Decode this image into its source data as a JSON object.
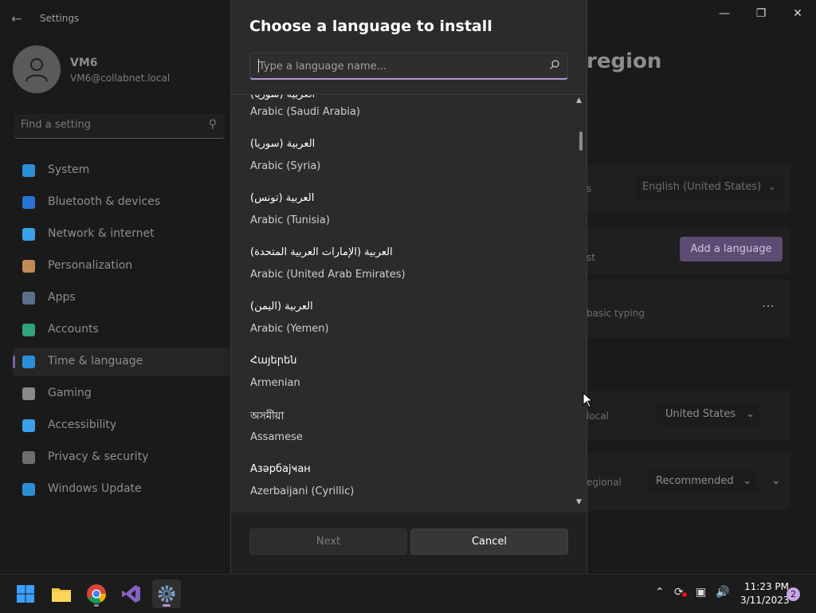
{
  "settings": {
    "title": "Settings",
    "user": {
      "name": "VM6",
      "email": "VM6@collabnet.local"
    },
    "search_placeholder": "Find a setting",
    "nav": [
      {
        "label": "System",
        "icon": "system-icon",
        "color": "#2b8fd6"
      },
      {
        "label": "Bluetooth & devices",
        "icon": "bluetooth-icon",
        "color": "#2b73d6"
      },
      {
        "label": "Network & internet",
        "icon": "wifi-icon",
        "color": "#3aa0e8"
      },
      {
        "label": "Personalization",
        "icon": "brush-icon",
        "color": "#c08a58"
      },
      {
        "label": "Apps",
        "icon": "apps-icon",
        "color": "#5a6f8a"
      },
      {
        "label": "Accounts",
        "icon": "accounts-icon",
        "color": "#2fa37a"
      },
      {
        "label": "Time & language",
        "icon": "globe-icon",
        "color": "#2b8fd6"
      },
      {
        "label": "Gaming",
        "icon": "controller-icon",
        "color": "#8a8a8a"
      },
      {
        "label": "Accessibility",
        "icon": "accessibility-icon",
        "color": "#3aa0e8"
      },
      {
        "label": "Privacy & security",
        "icon": "shield-icon",
        "color": "#6e6e6e"
      },
      {
        "label": "Windows Update",
        "icon": "update-icon",
        "color": "#2b8fd6"
      }
    ],
    "heading_fragment": "region",
    "rows": {
      "display_lang_suffix": "s",
      "display_lang_value": "English (United States)",
      "preferred_suffix": "st",
      "add_language": "Add a language",
      "typing_fragment": "basic typing",
      "region_suffix": "local",
      "country_value": "United States",
      "format_suffix": "egional",
      "format_value": "Recommended"
    }
  },
  "dialog": {
    "title": "Choose a language to install",
    "search_placeholder": "Type a language name...",
    "languages": [
      {
        "native": "العربية (سوريا)",
        "english": "Arabic (Saudi Arabia)"
      },
      {
        "native": "العربية (سوريا)",
        "english": "Arabic (Syria)"
      },
      {
        "native": "العربية (تونس)",
        "english": "Arabic (Tunisia)"
      },
      {
        "native": "العربية (الإمارات العربية المتحدة)",
        "english": "Arabic (United Arab Emirates)"
      },
      {
        "native": "العربية (اليمن)",
        "english": "Arabic (Yemen)"
      },
      {
        "native": "Հայերեն",
        "english": "Armenian"
      },
      {
        "native": "অসমীয়া",
        "english": "Assamese"
      },
      {
        "native": "Азәрбајҹан",
        "english": "Azerbaijani (Cyrillic)"
      }
    ],
    "next_label": "Next",
    "cancel_label": "Cancel"
  },
  "taskbar": {
    "time": "11:23 PM",
    "date": "3/11/2023",
    "notifications": "2"
  }
}
